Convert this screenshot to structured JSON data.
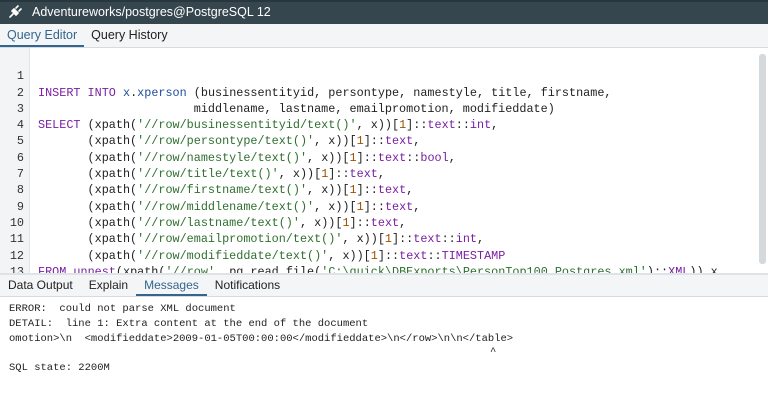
{
  "window": {
    "title": "Adventureworks/postgres@PostgreSQL 12",
    "icon": "plug-icon"
  },
  "top_tabs": [
    {
      "label": "Query Editor",
      "active": true
    },
    {
      "label": "Query History",
      "active": false
    }
  ],
  "editor": {
    "line_numbers": [
      "1",
      "2",
      "3",
      "4",
      "5",
      "6",
      "7",
      "8",
      "9",
      "10",
      "11",
      "12",
      "13"
    ]
  },
  "bottom_tabs": [
    {
      "label": "Data Output",
      "active": false
    },
    {
      "label": "Explain",
      "active": false
    },
    {
      "label": "Messages",
      "active": true
    },
    {
      "label": "Notifications",
      "active": false
    }
  ],
  "messages": {
    "error": "ERROR:  could not parse XML document",
    "detail": "DETAIL:  line 1: Extra content at the end of the document",
    "context": "omotion>\\n  <modifieddate>2009-01-05T00:00:00</modifieddate>\\n</row>\\n\\n</table>",
    "caret": "^",
    "sql_state": "SQL state: 2200M"
  },
  "colors": {
    "titlebar": "#36464f",
    "accent": "#326690",
    "keyword": "#7a1fa2",
    "string": "#2f6f2f"
  }
}
